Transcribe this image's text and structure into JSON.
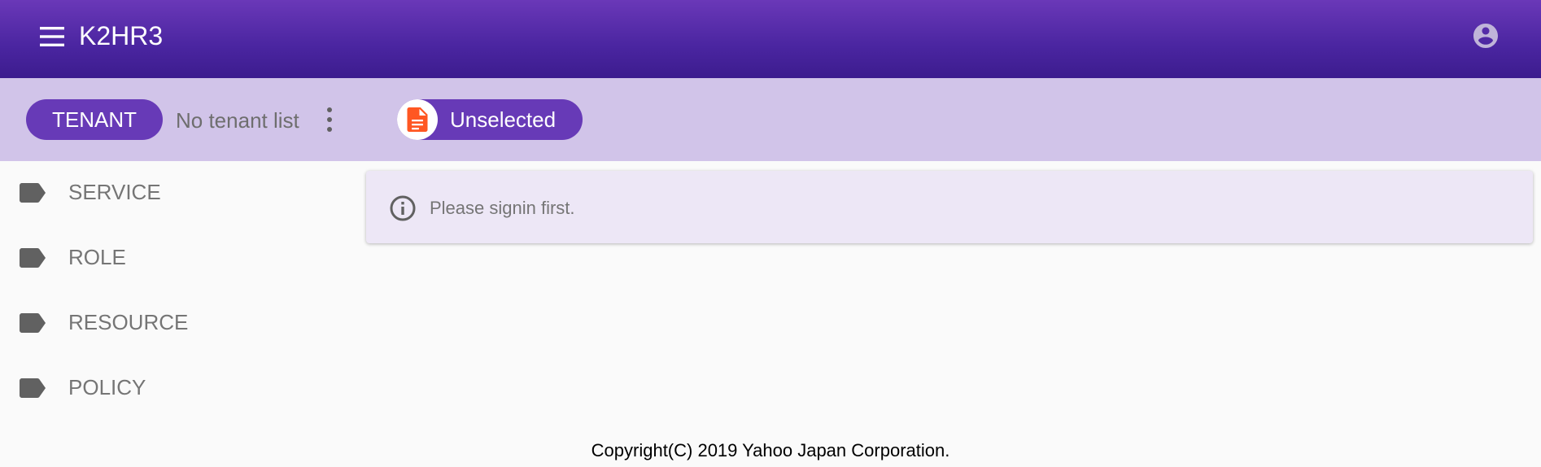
{
  "app": {
    "title": "K2HR3"
  },
  "toolbar": {
    "tenant_button": "TENANT",
    "tenant_status": "No tenant list",
    "selection_chip": "Unselected"
  },
  "sidebar": {
    "items": [
      {
        "label": "SERVICE"
      },
      {
        "label": "ROLE"
      },
      {
        "label": "RESOURCE"
      },
      {
        "label": "POLICY"
      }
    ]
  },
  "main": {
    "alert_message": "Please signin first."
  },
  "footer": {
    "copyright": "Copyright(C) 2019 Yahoo Japan Corporation."
  },
  "colors": {
    "primary": "#673ab7",
    "toolbar_bg": "#d1c4e9",
    "document_icon": "#ff5722"
  },
  "icons": {
    "menu": "menu-icon",
    "account": "account-circle-icon",
    "more": "more-vert-icon",
    "document": "document-icon",
    "nav": "label-tag-icon",
    "info": "info-outline-icon"
  }
}
